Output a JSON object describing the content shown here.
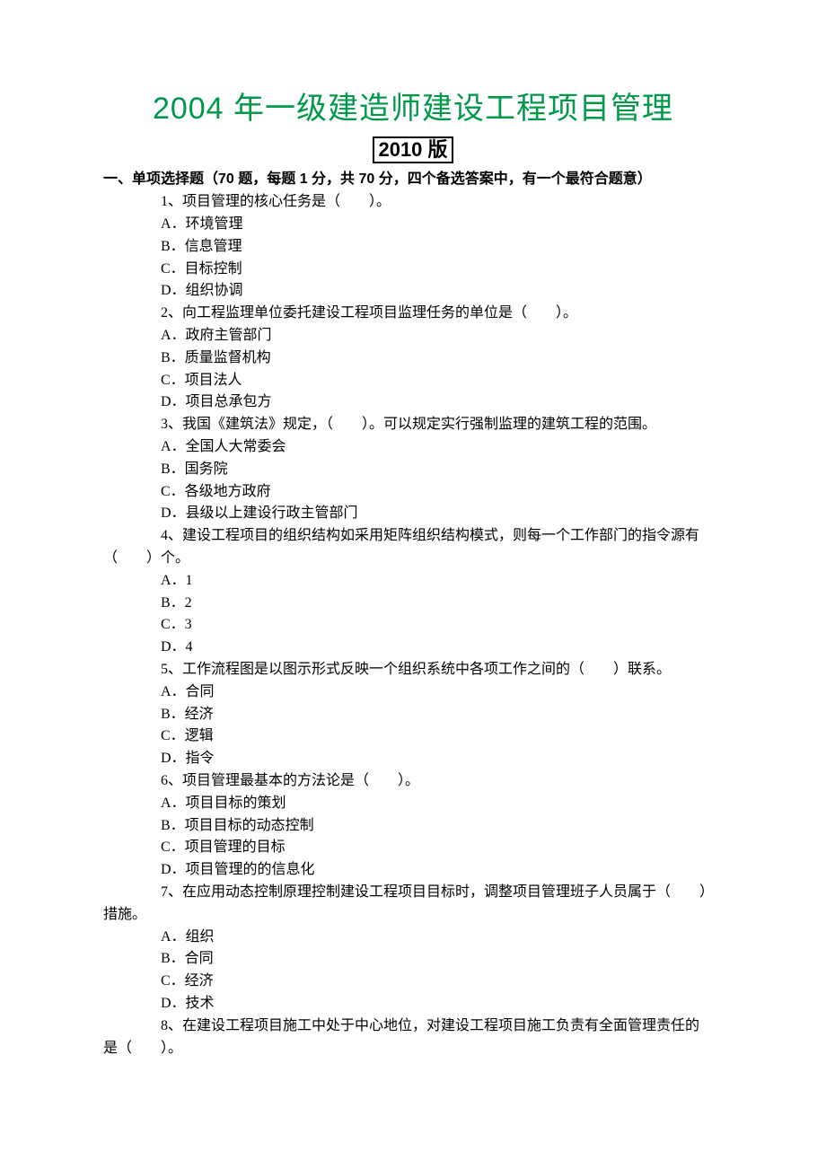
{
  "title": "2004 年一级建造师建设工程项目管理",
  "subtitle": "2010 版",
  "section_heading": "一、单项选择题（70 题，每题 1 分，共 70 分，四个备选答案中，有一个最符合题意）",
  "questions": [
    {
      "stem": "1、项目管理的核心任务是（　　）。",
      "options": [
        "A．环境管理",
        "B．信息管理",
        "C．目标控制",
        "D．组织协调"
      ]
    },
    {
      "stem": "2、向工程监理单位委托建设工程项目监理任务的单位是（　　）。",
      "options": [
        "A．政府主管部门",
        "B．质量监督机构",
        "C．项目法人",
        "D．项目总承包方"
      ]
    },
    {
      "stem": "3、我国《建筑法》规定，（　　）。可以规定实行强制监理的建筑工程的范围。",
      "options": [
        "A．全国人大常委会",
        "B．国务院",
        "C．各级地方政府",
        "D．县级以上建设行政主管部门"
      ]
    },
    {
      "stem": "4、建设工程项目的组织结构如采用矩阵组织结构模式，则每一个工作部门的指令源有",
      "cont": "（　　）个。",
      "options": [
        "A．1",
        "B．2",
        "C．3",
        "D．4"
      ]
    },
    {
      "stem": "5、工作流程图是以图示形式反映一个组织系统中各项工作之间的（　　）联系。",
      "options": [
        "A．合同",
        "B．经济",
        "C．逻辑",
        "D．指令"
      ]
    },
    {
      "stem": "6、项目管理最基本的方法论是（　　）。",
      "options": [
        "A．项目目标的策划",
        "B．项目目标的动态控制",
        "C．项目管理的目标",
        "D．项目管理的的信息化"
      ]
    },
    {
      "stem": "7、在应用动态控制原理控制建设工程项目目标时，调整项目管理班子人员属于（　　）",
      "cont": "措施。",
      "options": [
        "A．组织",
        "B．合同",
        "C．经济",
        "D．技术"
      ]
    },
    {
      "stem": "8、在建设工程项目施工中处于中心地位，对建设工程项目施工负责有全面管理责任的",
      "cont": "是（　　）。",
      "options": []
    }
  ]
}
